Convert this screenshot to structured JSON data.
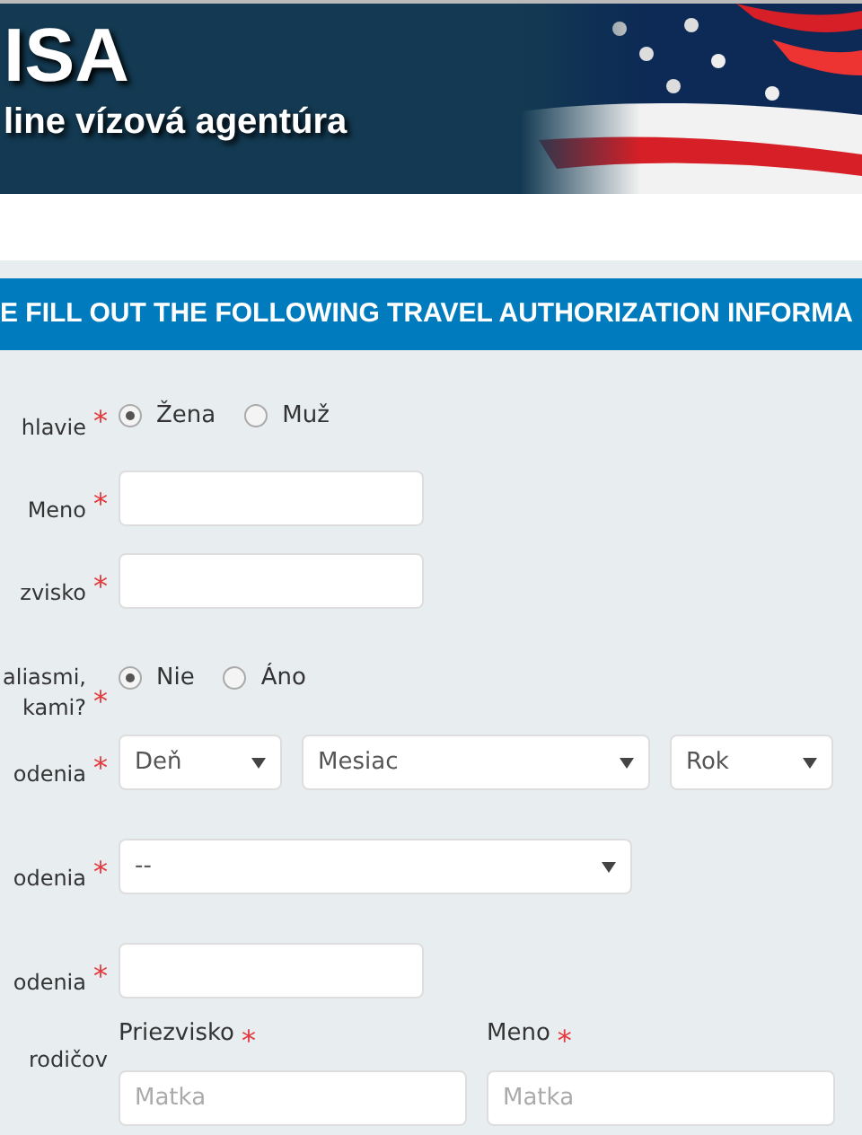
{
  "header": {
    "logo": "ISA",
    "tagline": "line vízová agentúra"
  },
  "section_title": "E FILL OUT THE FOLLOWING TRAVEL AUTHORIZATION INFORMA",
  "rows": [
    {
      "kind": "radio",
      "label": "hlavie",
      "required_mark": "*",
      "options": [
        {
          "label": "Žena",
          "selected": true
        },
        {
          "label": "Muž",
          "selected": false
        }
      ]
    },
    {
      "kind": "text",
      "label": "Meno",
      "required_mark": "*"
    },
    {
      "kind": "text",
      "label": "zvisko",
      "required_mark": "*"
    },
    {
      "kind": "radio",
      "label": "aliasmi,\nkami?",
      "required_mark": "*",
      "options": [
        {
          "label": "Nie",
          "selected": true
        },
        {
          "label": "Áno",
          "selected": false
        }
      ]
    },
    {
      "kind": "selects",
      "label": "odenia",
      "required_mark": "*",
      "selects": [
        {
          "value": "Deň"
        },
        {
          "value": "Mesiac"
        },
        {
          "value": "Rok"
        }
      ]
    },
    {
      "kind": "selects",
      "label": "odenia",
      "required_mark": "*",
      "selects": [
        {
          "value": "--"
        }
      ]
    },
    {
      "kind": "text",
      "label": "odenia",
      "required_mark": "*"
    },
    {
      "kind": "parents",
      "label": "rodičov",
      "fields": [
        {
          "label": "Priezvisko",
          "required_mark": "*",
          "placeholder": "Matka"
        },
        {
          "label": "Meno",
          "required_mark": "*",
          "placeholder": "Matka"
        }
      ]
    }
  ]
}
